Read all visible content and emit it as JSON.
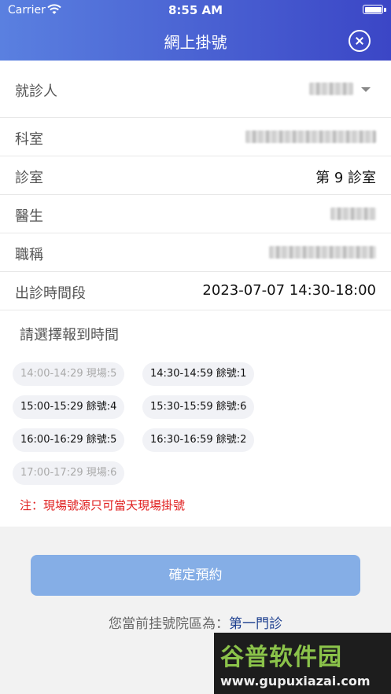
{
  "status_bar": {
    "carrier": "Carrier",
    "time": "8:55 AM",
    "wifi_icon": "wifi-icon",
    "battery_icon": "battery-icon"
  },
  "header": {
    "title": "網上掛號",
    "close_icon": "close-circle-icon"
  },
  "form": {
    "patient_label": "就診人",
    "department_label": "科室",
    "room_label": "診室",
    "room_value": "第 9 診室",
    "doctor_label": "醫生",
    "title_label": "職稱",
    "period_label": "出診時間段",
    "period_value": "2023-07-07 14:30-18:00"
  },
  "slots_title": "請選擇報到時間",
  "slots": [
    {
      "label": "14:00-14:29 現場:5",
      "state": "disabled"
    },
    {
      "label": "14:30-14:59 餘號:1",
      "state": "enabled"
    },
    {
      "label": "15:00-15:29 餘號:4",
      "state": "enabled"
    },
    {
      "label": "15:30-15:59 餘號:6",
      "state": "enabled"
    },
    {
      "label": "16:00-16:29 餘號:5",
      "state": "enabled"
    },
    {
      "label": "16:30-16:59 餘號:2",
      "state": "enabled"
    },
    {
      "label": "17:00-17:29 現場:6",
      "state": "disabled"
    }
  ],
  "note": "注：現場號源只可當天現場掛號",
  "confirm_label": "確定預約",
  "campus_prefix": "您當前挂號院區為：",
  "campus_name": "第一門診",
  "watermark": {
    "top": "谷普软件园",
    "bottom": "www.gupuxiazai.com"
  },
  "colors": {
    "header_start": "#5a80e0",
    "header_end": "#3b46c6",
    "button": "#85aee6",
    "note": "#e02020",
    "campus": "#1d3f8f"
  }
}
